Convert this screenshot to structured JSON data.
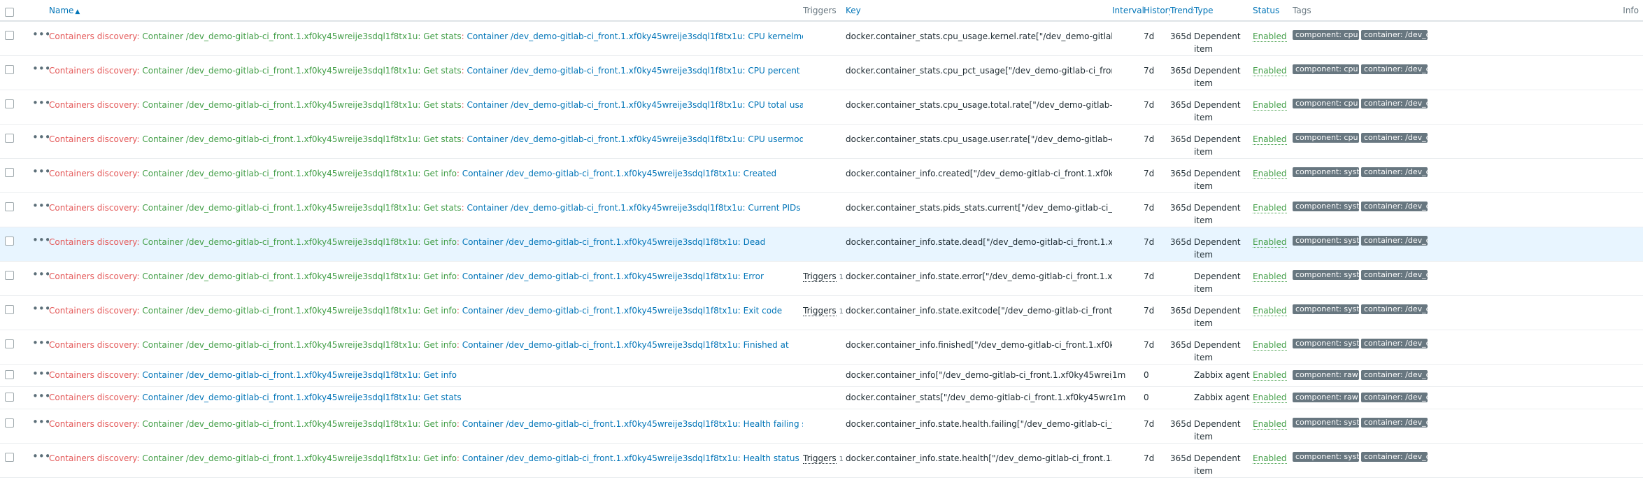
{
  "header": {
    "name": "Name",
    "triggers": "Triggers",
    "key": "Key",
    "interval": "Interval",
    "history": "History",
    "trends": "Trends",
    "type": "Type",
    "status": "Status",
    "tags": "Tags",
    "info": "Info",
    "sort_icon": "sort-ascending-icon"
  },
  "colors": {
    "link_blue": "#0275b8",
    "discovery_red": "#e45959",
    "host_green": "#429e47",
    "tag_bg": "#687780",
    "highlight_row": "#e8f5ff"
  },
  "rows": [
    {
      "prefix": "Containers discovery",
      "host": "Container /dev_demo-gitlab-ci_front.1.xf0ky45wreije3sdql1f8tx1u: Get stats",
      "sep": ": ",
      "item": "Container /dev_demo-gitlab-ci_front.1.xf0ky45wreije3sdql1f8tx1u: CPU kernelmode usage per second",
      "trigger_label": "",
      "trigger_count": "",
      "key": "docker.container_stats.cpu_usage.kernel.rate[\"/dev_demo-gitlab-ci_front.1.xf0ky45wreije3sdql1f8tx1u\"]",
      "interval": "",
      "history": "7d",
      "trends": "365d",
      "type": "Dependent item",
      "status": "Enabled",
      "tags": [
        "component: cpu",
        "container: /dev_demo-..."
      ]
    },
    {
      "prefix": "Containers discovery",
      "host": "Container /dev_demo-gitlab-ci_front.1.xf0ky45wreije3sdql1f8tx1u: Get stats",
      "sep": ": ",
      "item": "Container /dev_demo-gitlab-ci_front.1.xf0ky45wreije3sdql1f8tx1u: CPU percent usage",
      "trigger_label": "",
      "trigger_count": "",
      "key": "docker.container_stats.cpu_pct_usage[\"/dev_demo-gitlab-ci_front.1.xf0ky45wreije3sdql1f8tx1u\"]",
      "interval": "",
      "history": "7d",
      "trends": "365d",
      "type": "Dependent item",
      "status": "Enabled",
      "tags": [
        "component: cpu",
        "container: /dev_demo-..."
      ]
    },
    {
      "prefix": "Containers discovery",
      "host": "Container /dev_demo-gitlab-ci_front.1.xf0ky45wreije3sdql1f8tx1u: Get stats",
      "sep": ": ",
      "item": "Container /dev_demo-gitlab-ci_front.1.xf0ky45wreije3sdql1f8tx1u: CPU total usage per second",
      "trigger_label": "",
      "trigger_count": "",
      "key": "docker.container_stats.cpu_usage.total.rate[\"/dev_demo-gitlab-ci_front.1.xf0ky45wreije3sdql1f8tx1u\"]",
      "interval": "",
      "history": "7d",
      "trends": "365d",
      "type": "Dependent item",
      "status": "Enabled",
      "tags": [
        "component: cpu",
        "container: /dev_demo-..."
      ]
    },
    {
      "prefix": "Containers discovery",
      "host": "Container /dev_demo-gitlab-ci_front.1.xf0ky45wreije3sdql1f8tx1u: Get stats",
      "sep": ": ",
      "item": "Container /dev_demo-gitlab-ci_front.1.xf0ky45wreije3sdql1f8tx1u: CPU usermode usage per second",
      "trigger_label": "",
      "trigger_count": "",
      "key": "docker.container_stats.cpu_usage.user.rate[\"/dev_demo-gitlab-ci_front.1.xf0ky45wreije3sdql1f8tx1u\"]",
      "interval": "",
      "history": "7d",
      "trends": "365d",
      "type": "Dependent item",
      "status": "Enabled",
      "tags": [
        "component: cpu",
        "container: /dev_demo-..."
      ]
    },
    {
      "prefix": "Containers discovery",
      "host": "Container /dev_demo-gitlab-ci_front.1.xf0ky45wreije3sdql1f8tx1u: Get info",
      "sep": ": ",
      "item": "Container /dev_demo-gitlab-ci_front.1.xf0ky45wreije3sdql1f8tx1u: Created",
      "trigger_label": "",
      "trigger_count": "",
      "key": "docker.container_info.created[\"/dev_demo-gitlab-ci_front.1.xf0ky45wreije3sdql1f8tx1u\"]",
      "interval": "",
      "history": "7d",
      "trends": "365d",
      "type": "Dependent item",
      "status": "Enabled",
      "tags": [
        "component: system",
        "container: /dev_demo-..."
      ]
    },
    {
      "prefix": "Containers discovery",
      "host": "Container /dev_demo-gitlab-ci_front.1.xf0ky45wreije3sdql1f8tx1u: Get stats",
      "sep": ": ",
      "item": "Container /dev_demo-gitlab-ci_front.1.xf0ky45wreije3sdql1f8tx1u: Current PIDs count",
      "trigger_label": "",
      "trigger_count": "",
      "key": "docker.container_stats.pids_stats.current[\"/dev_demo-gitlab-ci_front.1.xf0ky45wreije3sdql1f8tx1u\"]",
      "interval": "",
      "history": "7d",
      "trends": "365d",
      "type": "Dependent item",
      "status": "Enabled",
      "tags": [
        "component: system",
        "container: /dev_demo-..."
      ]
    },
    {
      "prefix": "Containers discovery",
      "host": "Container /dev_demo-gitlab-ci_front.1.xf0ky45wreije3sdql1f8tx1u: Get info",
      "sep": ": ",
      "item": "Container /dev_demo-gitlab-ci_front.1.xf0ky45wreije3sdql1f8tx1u: Dead",
      "trigger_label": "",
      "trigger_count": "",
      "key": "docker.container_info.state.dead[\"/dev_demo-gitlab-ci_front.1.xf0ky45wreije3sdql1f8tx1u\"]",
      "interval": "",
      "history": "7d",
      "trends": "365d",
      "type": "Dependent item",
      "status": "Enabled",
      "tags": [
        "component: system",
        "container: /dev_demo-..."
      ],
      "highlight": true
    },
    {
      "prefix": "Containers discovery",
      "host": "Container /dev_demo-gitlab-ci_front.1.xf0ky45wreije3sdql1f8tx1u: Get info",
      "sep": ": ",
      "item": "Container /dev_demo-gitlab-ci_front.1.xf0ky45wreije3sdql1f8tx1u: Error",
      "trigger_label": "Triggers",
      "trigger_count": "1",
      "key": "docker.container_info.state.error[\"/dev_demo-gitlab-ci_front.1.xf0ky45wreije3sdql1f8tx1u\"]",
      "interval": "",
      "history": "7d",
      "trends": "",
      "type": "Dependent item",
      "status": "Enabled",
      "tags": [
        "component: system",
        "container: /dev_demo-..."
      ]
    },
    {
      "prefix": "Containers discovery",
      "host": "Container /dev_demo-gitlab-ci_front.1.xf0ky45wreije3sdql1f8tx1u: Get info",
      "sep": ": ",
      "item": "Container /dev_demo-gitlab-ci_front.1.xf0ky45wreije3sdql1f8tx1u: Exit code",
      "trigger_label": "Triggers",
      "trigger_count": "1",
      "key": "docker.container_info.state.exitcode[\"/dev_demo-gitlab-ci_front.1.xf0ky45wreije3sdql1f8tx1u\"]",
      "interval": "",
      "history": "7d",
      "trends": "365d",
      "type": "Dependent item",
      "status": "Enabled",
      "tags": [
        "component: system",
        "container: /dev_demo-..."
      ]
    },
    {
      "prefix": "Containers discovery",
      "host": "Container /dev_demo-gitlab-ci_front.1.xf0ky45wreije3sdql1f8tx1u: Get info",
      "sep": ": ",
      "item": "Container /dev_demo-gitlab-ci_front.1.xf0ky45wreije3sdql1f8tx1u: Finished at",
      "trigger_label": "",
      "trigger_count": "",
      "key": "docker.container_info.finished[\"/dev_demo-gitlab-ci_front.1.xf0ky45wreije3sdql1f8tx1u\"]",
      "interval": "",
      "history": "7d",
      "trends": "365d",
      "type": "Dependent item",
      "status": "Enabled",
      "tags": [
        "component: system",
        "container: /dev_demo-..."
      ]
    },
    {
      "prefix": "Containers discovery",
      "host": "",
      "sep": "",
      "item": "Container /dev_demo-gitlab-ci_front.1.xf0ky45wreije3sdql1f8tx1u: Get info",
      "trigger_label": "",
      "trigger_count": "",
      "key": "docker.container_info[\"/dev_demo-gitlab-ci_front.1.xf0ky45wreije3sdql1f8tx1u\",full]",
      "interval": "1m",
      "history": "0",
      "trends": "",
      "type": "Zabbix agent",
      "status": "Enabled",
      "tags": [
        "component: raw",
        "container: /dev_demo-..."
      ],
      "single": true
    },
    {
      "prefix": "Containers discovery",
      "host": "",
      "sep": "",
      "item": "Container /dev_demo-gitlab-ci_front.1.xf0ky45wreije3sdql1f8tx1u: Get stats",
      "trigger_label": "",
      "trigger_count": "",
      "key": "docker.container_stats[\"/dev_demo-gitlab-ci_front.1.xf0ky45wreije3sdql1f8tx1u\"]",
      "interval": "1m",
      "history": "0",
      "trends": "",
      "type": "Zabbix agent",
      "status": "Enabled",
      "tags": [
        "component: raw",
        "container: /dev_demo-..."
      ],
      "single": true
    },
    {
      "prefix": "Containers discovery",
      "host": "Container /dev_demo-gitlab-ci_front.1.xf0ky45wreije3sdql1f8tx1u: Get info",
      "sep": ": ",
      "item": "Container /dev_demo-gitlab-ci_front.1.xf0ky45wreije3sdql1f8tx1u: Health failing streak",
      "trigger_label": "",
      "trigger_count": "",
      "key": "docker.container_info.state.health.failing[\"/dev_demo-gitlab-ci_front.1.xf0ky45wreije3sdql1f8tx1u\"]",
      "interval": "",
      "history": "7d",
      "trends": "365d",
      "type": "Dependent item",
      "status": "Enabled",
      "tags": [
        "component: system",
        "container: /dev_demo-..."
      ]
    },
    {
      "prefix": "Containers discovery",
      "host": "Container /dev_demo-gitlab-ci_front.1.xf0ky45wreije3sdql1f8tx1u: Get info",
      "sep": ": ",
      "item": "Container /dev_demo-gitlab-ci_front.1.xf0ky45wreije3sdql1f8tx1u: Health status",
      "trigger_label": "Triggers",
      "trigger_count": "1",
      "key": "docker.container_info.state.health[\"/dev_demo-gitlab-ci_front.1.xf0ky45wreije3sdql1f8tx1u\"]",
      "interval": "",
      "history": "7d",
      "trends": "365d",
      "type": "Dependent item",
      "status": "Enabled",
      "tags": [
        "component: system",
        "container: /dev_demo-..."
      ]
    }
  ]
}
